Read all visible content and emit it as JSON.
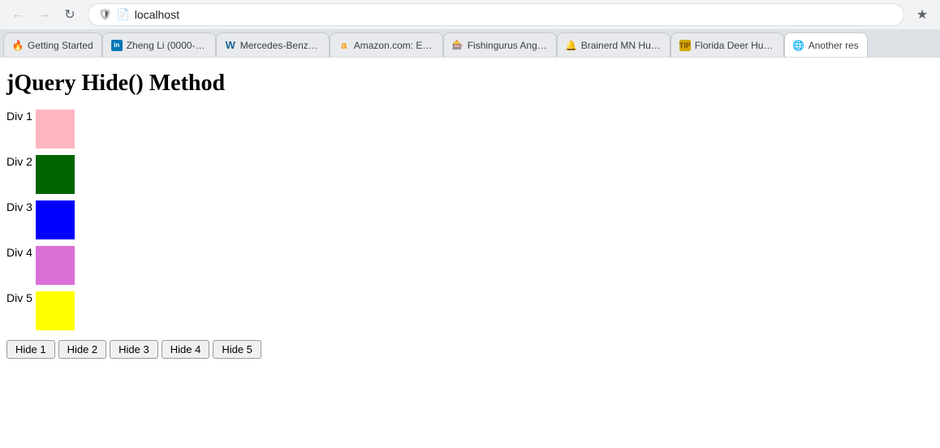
{
  "browser": {
    "address": "localhost",
    "tabs": [
      {
        "id": "tab-getting-started",
        "label": "Getting Started",
        "favicon": "fire",
        "active": false
      },
      {
        "id": "tab-zheng-li",
        "label": "Zheng Li (0000-0002-3...",
        "favicon": "in",
        "active": false
      },
      {
        "id": "tab-mercedes",
        "label": "Mercedes-Benz G-Clas...",
        "favicon": "w",
        "active": false
      },
      {
        "id": "tab-amazon",
        "label": "Amazon.com: ExpertP...",
        "favicon": "a",
        "active": false
      },
      {
        "id": "tab-fishingurus",
        "label": "Fishingurus Angler's I...",
        "favicon": "fish",
        "active": false
      },
      {
        "id": "tab-brainerd",
        "label": "Brainerd MN Hunting ...",
        "favicon": "bell",
        "active": false
      },
      {
        "id": "tab-florida",
        "label": "Florida Deer Hunting S...",
        "favicon": "tip",
        "active": false
      },
      {
        "id": "tab-another",
        "label": "Another res",
        "favicon": "globe",
        "active": true
      }
    ]
  },
  "page": {
    "title": "jQuery Hide() Method",
    "divs": [
      {
        "id": "div1",
        "label": "Div 1",
        "color": "#ffb6c1"
      },
      {
        "id": "div2",
        "label": "Div 2",
        "color": "#006400"
      },
      {
        "id": "div3",
        "label": "Div 3",
        "color": "#0000ff"
      },
      {
        "id": "div4",
        "label": "Div 4",
        "color": "#da70d6"
      },
      {
        "id": "div5",
        "label": "Div 5",
        "color": "#ffff00"
      }
    ],
    "buttons": [
      {
        "id": "btn1",
        "label": "Hide 1"
      },
      {
        "id": "btn2",
        "label": "Hide 2"
      },
      {
        "id": "btn3",
        "label": "Hide 3"
      },
      {
        "id": "btn4",
        "label": "Hide 4"
      },
      {
        "id": "btn5",
        "label": "Hide 5"
      }
    ]
  }
}
